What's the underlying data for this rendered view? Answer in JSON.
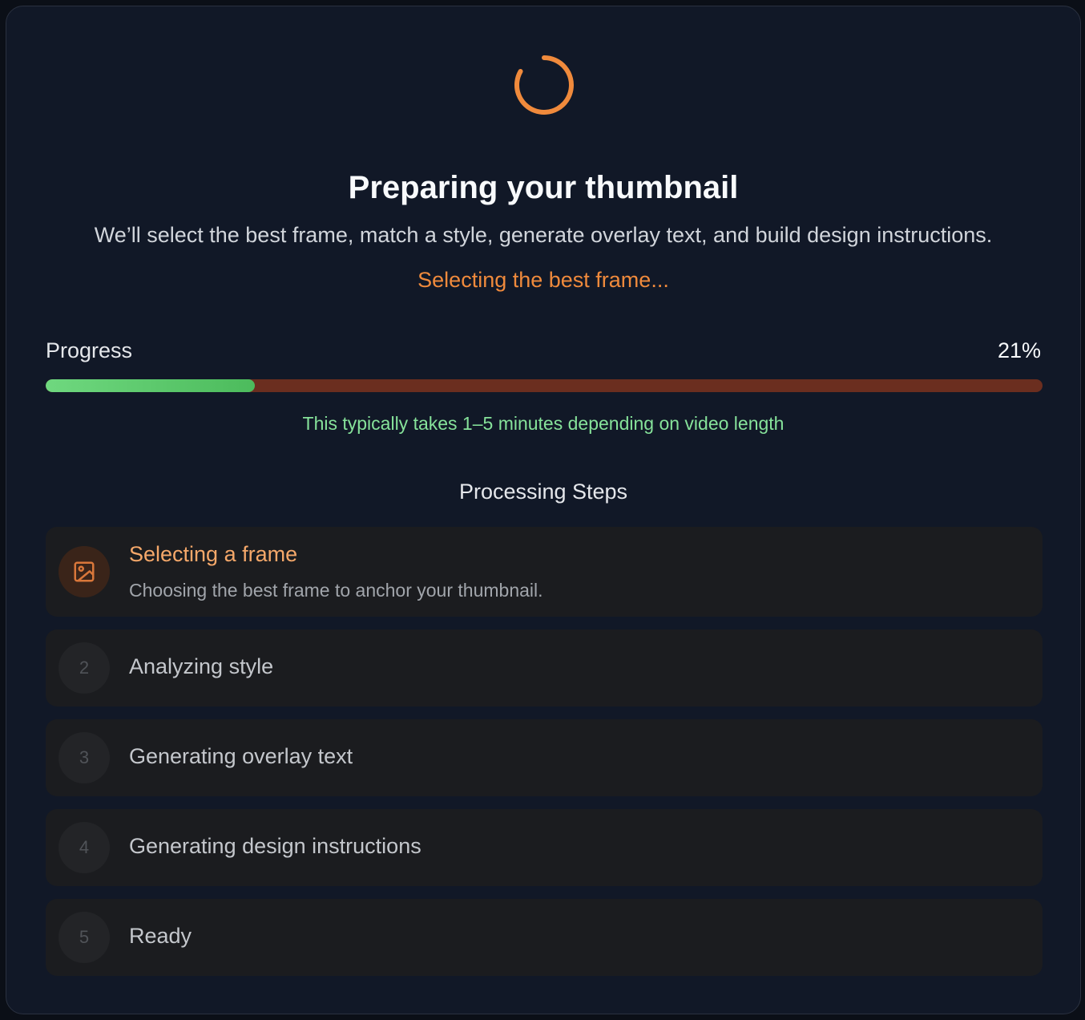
{
  "header": {
    "title": "Preparing your thumbnail",
    "subtitle": "We’ll select the best frame, match a style, generate overlay text, and build design instructions.",
    "status": "Selecting the best frame..."
  },
  "progress": {
    "label": "Progress",
    "value_text": "21%",
    "fraction": 0.21,
    "hint": "This typically takes 1–5 minutes depending on video length"
  },
  "steps_heading": "Processing Steps",
  "steps": [
    {
      "number": "1",
      "icon": "image-icon",
      "title": "Selecting a frame",
      "description": "Choosing the best frame to anchor your thumbnail.",
      "state": "active"
    },
    {
      "number": "2",
      "title": "Analyzing style",
      "state": "pending"
    },
    {
      "number": "3",
      "title": "Generating overlay text",
      "state": "pending"
    },
    {
      "number": "4",
      "title": "Generating design instructions",
      "state": "pending"
    },
    {
      "number": "5",
      "title": "Ready",
      "state": "pending"
    }
  ],
  "colors": {
    "accent": "#f08a3c",
    "progress_fill": "#5fcb6e",
    "progress_track": "#6b2e1f",
    "hint": "#86e29a",
    "card_bg": "#111827",
    "step_bg": "#1b1c1f"
  }
}
